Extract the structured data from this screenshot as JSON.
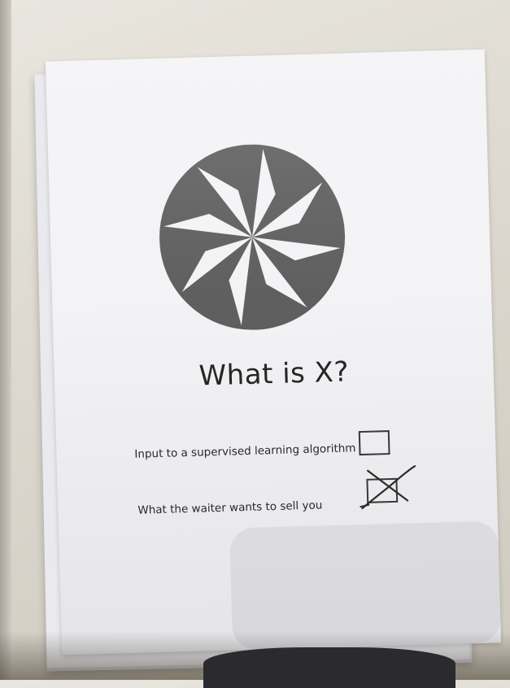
{
  "photo": {
    "description_tag": "printed-questionnaire-sheet"
  },
  "question": {
    "title": "What is X?"
  },
  "options": [
    {
      "label": "Input to a supervised learning algorithm",
      "checked": false
    },
    {
      "label": "What the waiter wants to sell you",
      "checked": true
    }
  ],
  "colors": {
    "logo_gray": "#5f5f60",
    "paper": "#f3f3f6",
    "ink": "#2a2a2a"
  }
}
